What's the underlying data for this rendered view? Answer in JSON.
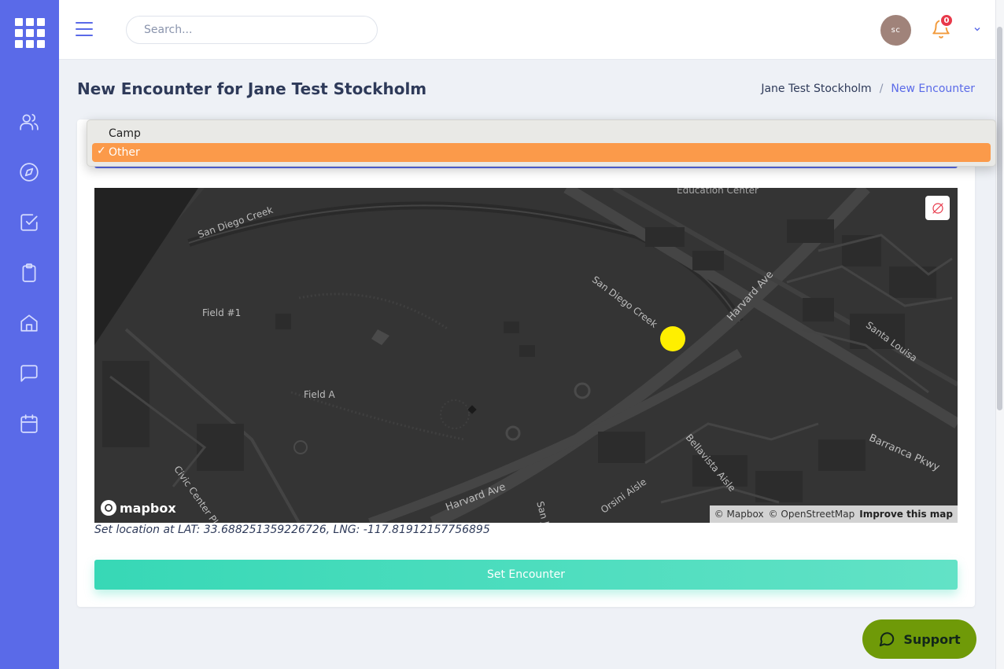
{
  "header": {
    "search_placeholder": "Search...",
    "avatar_initials": "sc",
    "notification_count": "0"
  },
  "page": {
    "title": "New Encounter for Jane Test Stockholm",
    "breadcrumb": [
      "Jane Test Stockholm",
      "/",
      "New Encounter"
    ]
  },
  "dropdown": {
    "options": [
      "Camp",
      "Other"
    ],
    "selected": "Other",
    "check_glyph": "✓"
  },
  "map": {
    "labels": {
      "education_center": "Education Center",
      "san_diego_creek_top": "San Diego Creek",
      "san_diego_creek_mid": "San Diego Creek",
      "harvard_ave_ne": "Harvard Ave",
      "santa_louisa": "Santa Louisa",
      "field_1": "Field #1",
      "field_a": "Field A",
      "bellavista_aisle": "Bellavista Aisle",
      "barranca_pkwy": "Barranca Pkwy",
      "orsini_aisle": "Orsini Aisle",
      "harvard_ave_sw": "Harvard Ave",
      "civic_center": "Civic Center Pla",
      "san_j": "San J"
    },
    "logo_text": "mapbox",
    "attribution": [
      "© Mapbox",
      "© OpenStreetMap"
    ],
    "improve_link": "Improve this map",
    "marker_color": "#ffef00"
  },
  "location": {
    "lat": "33.688251359226726",
    "lng": "-117.81912157756895",
    "text": "Set location at LAT: 33.688251359226726, LNG: -117.81912157756895"
  },
  "actions": {
    "set_encounter": "Set Encounter",
    "support": "Support"
  },
  "colors": {
    "sidebar": "#5a6ae8",
    "accent": "#5a6ae8",
    "selected_option": "#fb9a4a",
    "button_gradient_start": "#37d8b6",
    "support_bg": "#6f9a08",
    "badge": "#e8394a"
  },
  "sidebar_icons": [
    "users-icon",
    "compass-icon",
    "checkbox-icon",
    "clipboard-icon",
    "home-icon",
    "chat-icon",
    "calendar-icon"
  ]
}
